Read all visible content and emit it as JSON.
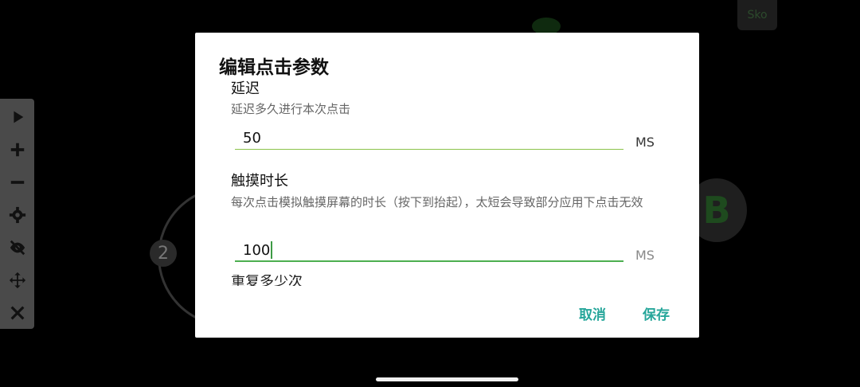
{
  "background": {
    "toolbar": {
      "items": [
        {
          "name": "play-icon"
        },
        {
          "name": "plus-icon"
        },
        {
          "name": "minus-icon"
        },
        {
          "name": "gear-icon"
        },
        {
          "name": "eye-off-icon"
        },
        {
          "name": "move-icon"
        },
        {
          "name": "close-icon"
        }
      ]
    },
    "marker_label": "2",
    "b_label": "B",
    "top_button_label": "Sko"
  },
  "dialog": {
    "title": "编辑点击参数",
    "delay": {
      "title": "延迟",
      "description": "延迟多久进行本次点击",
      "value": "50",
      "unit": "MS"
    },
    "touch": {
      "title": "触摸时长",
      "description": "每次点击模拟触摸屏幕的时长（按下到抬起），太短会导致部分应用下点击无效",
      "value": "100",
      "unit": "MS"
    },
    "next_section_partial": "重复多少次",
    "cancel_label": "取消",
    "save_label": "保存",
    "accent_color": "#26a69a",
    "field_line_color": "#8bc34a"
  }
}
